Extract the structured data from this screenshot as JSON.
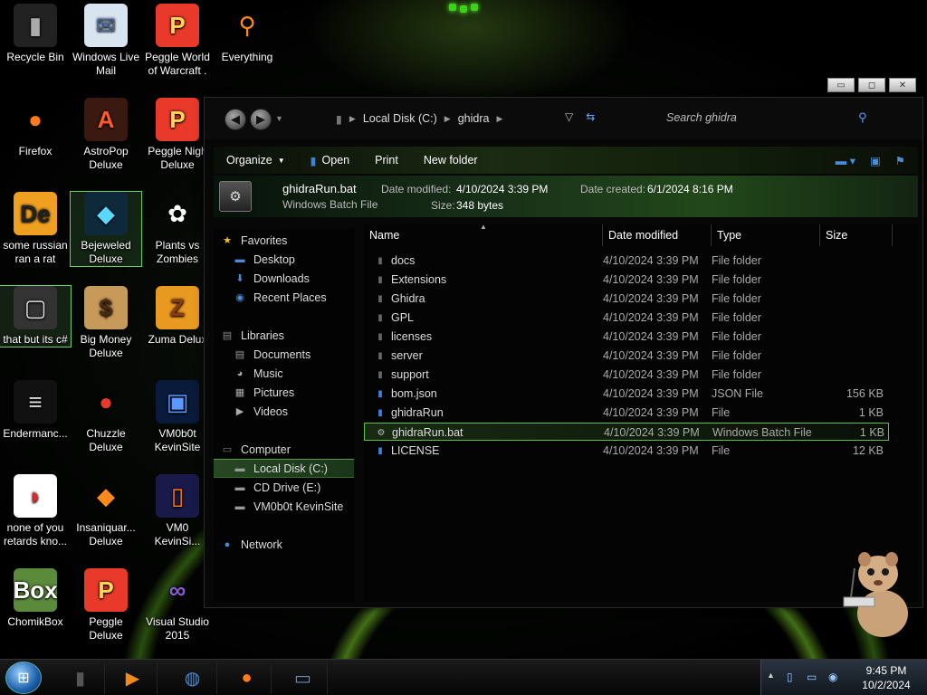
{
  "desktop_icons": [
    {
      "label": "Recycle Bin",
      "icon": "recycle-bin-icon"
    },
    {
      "label": "Windows Live Mail",
      "icon": "mail-icon"
    },
    {
      "label": "Peggle World of Warcraft .",
      "icon": "peggle-icon"
    },
    {
      "label": "Everything",
      "icon": "search-magnifier-icon"
    },
    {
      "label": "Firefox",
      "icon": "firefox-icon"
    },
    {
      "label": "AstroPop Deluxe",
      "icon": "astropop-icon"
    },
    {
      "label": "Peggle Nigh Deluxe",
      "icon": "peggle-icon"
    },
    {
      "label": "some russian ran a rat",
      "icon": "de-icon"
    },
    {
      "label": "Bejeweled Deluxe",
      "icon": "gem-icon"
    },
    {
      "label": "Plants vs Zombies",
      "icon": "flower-icon"
    },
    {
      "label": "that but its c#",
      "icon": "windows-stack-icon"
    },
    {
      "label": "Big Money Deluxe",
      "icon": "money-bag-icon"
    },
    {
      "label": "Zuma Delux",
      "icon": "zuma-icon"
    },
    {
      "label": "Endermanc...",
      "icon": "terminal-icon"
    },
    {
      "label": "Chuzzle Deluxe",
      "icon": "chuzzle-icon"
    },
    {
      "label": "VM0b0t KevinSite",
      "icon": "vm-icon"
    },
    {
      "label": "none of you retards kno...",
      "icon": "dragon-icon"
    },
    {
      "label": "Insaniquar... Deluxe",
      "icon": "fish-icon"
    },
    {
      "label": "VM0 KevinSi...",
      "icon": "firefox-doc-icon"
    },
    {
      "label": "ChomikBox",
      "icon": "chomik-box-icon"
    },
    {
      "label": "Peggle Deluxe",
      "icon": "peggle-icon"
    },
    {
      "label": "Visual Studio 2015",
      "icon": "visual-studio-icon"
    }
  ],
  "window": {
    "caption_buttons": [
      "▭",
      "◻",
      "✕"
    ],
    "breadcrumb": [
      "Local Disk (C:)",
      "ghidra"
    ],
    "search_placeholder": "Search ghidra",
    "toolbar": {
      "organize": "Organize",
      "open": "Open",
      "print": "Print",
      "new_folder": "New folder"
    },
    "details": {
      "name": "ghidraRun.bat",
      "type": "Windows Batch File",
      "modified_label": "Date modified:",
      "modified_value": "4/10/2024 3:39 PM",
      "created_label": "Date created:",
      "created_value": "6/1/2024 8:16 PM",
      "size_label": "Size:",
      "size_value": "348 bytes"
    },
    "nav": {
      "favorites": "Favorites",
      "desktop": "Desktop",
      "downloads": "Downloads",
      "recent": "Recent Places",
      "libraries": "Libraries",
      "documents": "Documents",
      "music": "Music",
      "pictures": "Pictures",
      "videos": "Videos",
      "computer": "Computer",
      "local_disk": "Local Disk (C:)",
      "cd_drive": "CD Drive (E:)",
      "vm": "VM0b0t KevinSite",
      "network": "Network"
    },
    "columns": {
      "name": "Name",
      "date": "Date modified",
      "type": "Type",
      "size": "Size"
    },
    "files": [
      {
        "name": "docs",
        "date": "4/10/2024 3:39 PM",
        "type": "File folder",
        "size": "",
        "kind": "folder"
      },
      {
        "name": "Extensions",
        "date": "4/10/2024 3:39 PM",
        "type": "File folder",
        "size": "",
        "kind": "folder"
      },
      {
        "name": "Ghidra",
        "date": "4/10/2024 3:39 PM",
        "type": "File folder",
        "size": "",
        "kind": "folder"
      },
      {
        "name": "GPL",
        "date": "4/10/2024 3:39 PM",
        "type": "File folder",
        "size": "",
        "kind": "folder"
      },
      {
        "name": "licenses",
        "date": "4/10/2024 3:39 PM",
        "type": "File folder",
        "size": "",
        "kind": "folder"
      },
      {
        "name": "server",
        "date": "4/10/2024 3:39 PM",
        "type": "File folder",
        "size": "",
        "kind": "folder"
      },
      {
        "name": "support",
        "date": "4/10/2024 3:39 PM",
        "type": "File folder",
        "size": "",
        "kind": "folder"
      },
      {
        "name": "bom.json",
        "date": "4/10/2024 3:39 PM",
        "type": "JSON File",
        "size": "156 KB",
        "kind": "file"
      },
      {
        "name": "ghidraRun",
        "date": "4/10/2024 3:39 PM",
        "type": "File",
        "size": "1 KB",
        "kind": "file"
      },
      {
        "name": "ghidraRun.bat",
        "date": "4/10/2024 3:39 PM",
        "type": "Windows Batch File",
        "size": "1 KB",
        "kind": "bat"
      },
      {
        "name": "LICENSE",
        "date": "4/10/2024 3:39 PM",
        "type": "File",
        "size": "12 KB",
        "kind": "file"
      }
    ]
  },
  "taskbar": {
    "items": [
      "dark-window-icon",
      "media-player-icon",
      "globe-icon",
      "firefox-icon",
      "explorer-window-icon"
    ],
    "clock_time": "9:45 PM",
    "clock_date": "10/2/2024"
  }
}
